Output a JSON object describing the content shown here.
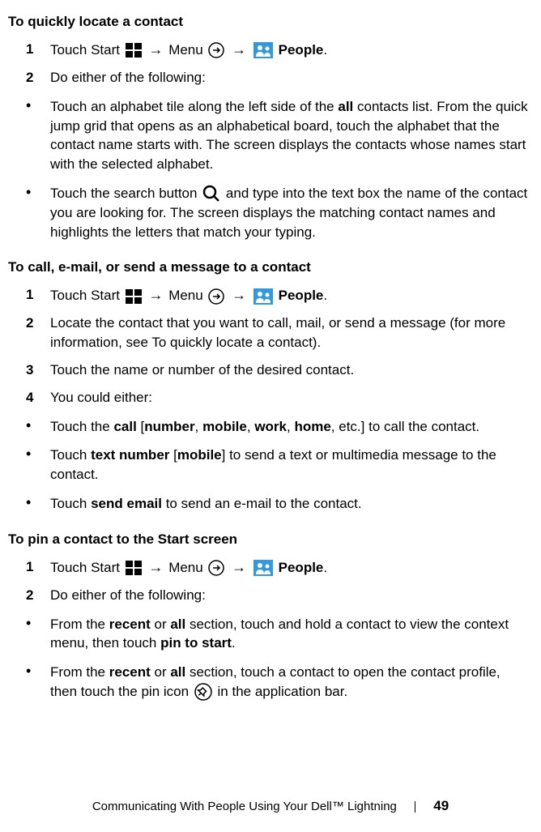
{
  "section1": {
    "heading": "To quickly locate a contact",
    "step1_num": "1",
    "step1_text_a": "Touch Start ",
    "step1_text_b": " Menu ",
    "step1_people": " People",
    "step1_period": ".",
    "step2_num": "2",
    "step2_text": "Do either of the following:",
    "bullet1_a": "Touch an alphabet tile along the left side of the ",
    "bullet1_all": "all",
    "bullet1_b": " contacts list. From the quick jump grid that opens as an alphabetical board, touch the alphabet that the contact name starts with. The screen displays the contacts whose names start with the selected alphabet.",
    "bullet2_a": "Touch the search button ",
    "bullet2_b": " and type into the text box the name of the contact you are looking for. The screen displays the matching contact names and highlights the letters that match your typing."
  },
  "section2": {
    "heading": "To call, e-mail, or send a message to a contact",
    "step1_num": "1",
    "step1_text_a": "Touch Start ",
    "step1_text_b": " Menu ",
    "step1_people": " People",
    "step1_period": ".",
    "step2_num": "2",
    "step2_text": "Locate the contact that you want to call, mail, or send a message (for more information, see To quickly locate a contact).",
    "step3_num": "3",
    "step3_text": "Touch the name or number of the desired contact.",
    "step4_num": "4",
    "step4_text": "You could either:",
    "bullet1_a": "Touch the ",
    "bullet1_call": "call",
    "bullet1_b": " [",
    "bullet1_number": "number",
    "bullet1_c": ", ",
    "bullet1_mobile": "mobile",
    "bullet1_d": ", ",
    "bullet1_work": "work",
    "bullet1_e": ", ",
    "bullet1_home": "home",
    "bullet1_f": ", etc.] to call the contact.",
    "bullet2_a": "Touch ",
    "bullet2_text_number": "text number",
    "bullet2_b": " [",
    "bullet2_mobile": "mobile",
    "bullet2_c": "] to send a text or multimedia message to the contact.",
    "bullet3_a": "Touch ",
    "bullet3_send_email": "send email",
    "bullet3_b": " to send an e-mail to the contact."
  },
  "section3": {
    "heading": "To pin a contact to the Start screen",
    "step1_num": "1",
    "step1_text_a": "Touch Start ",
    "step1_text_b": " Menu ",
    "step1_people": " People",
    "step1_period": ".",
    "step2_num": "2",
    "step2_text": "Do either of the following:",
    "bullet1_a": "From the ",
    "bullet1_recent": "recent",
    "bullet1_b": " or ",
    "bullet1_all": "all",
    "bullet1_c": " section, touch and hold a contact to view the context menu, then touch ",
    "bullet1_pin": "pin to start",
    "bullet1_d": ".",
    "bullet2_a": "From the ",
    "bullet2_recent": "recent",
    "bullet2_b": " or ",
    "bullet2_all": "all",
    "bullet2_c": " section, touch a contact to open the contact profile, then touch the pin icon ",
    "bullet2_d": " in the application bar."
  },
  "footer": {
    "title": "Communicating With People Using Your Dell™ Lightning",
    "page": "49"
  },
  "arrow": "→"
}
